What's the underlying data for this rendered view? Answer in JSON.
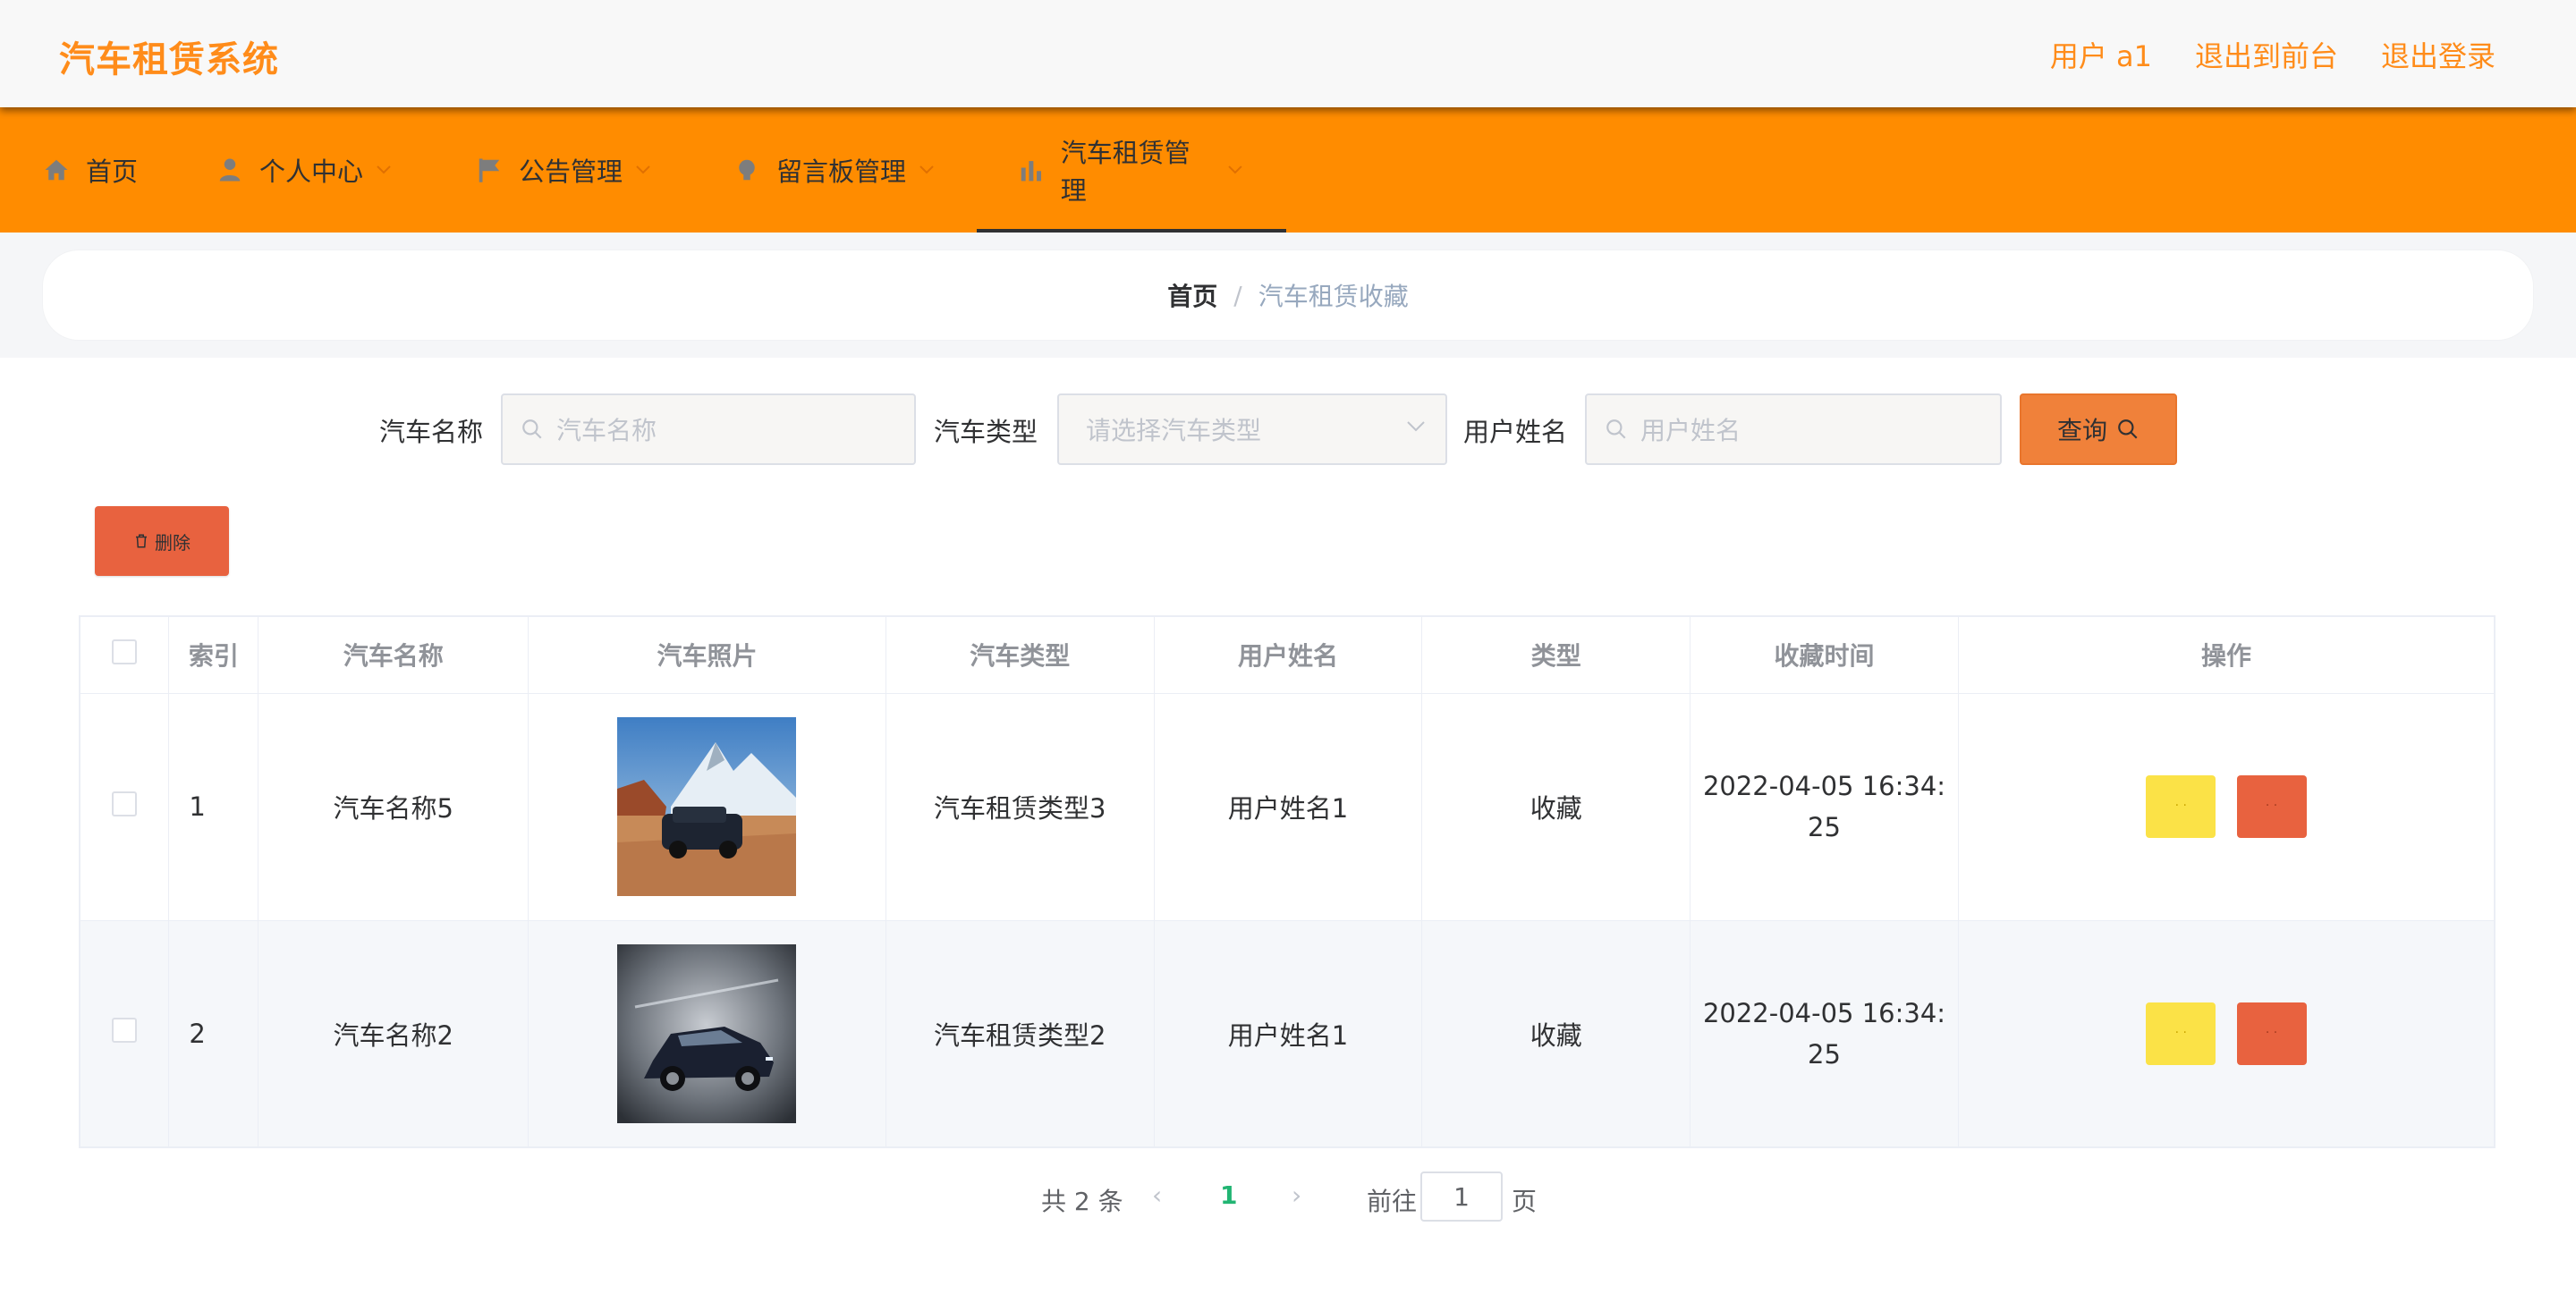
{
  "header": {
    "title": "汽车租赁系统",
    "user_label": "用户 a1",
    "to_front": "退出到前台",
    "logout": "退出登录",
    "accent_color": "#ff8c1a"
  },
  "nav": {
    "items": [
      {
        "label": "首页",
        "icon": "home-icon"
      },
      {
        "label": "个人中心",
        "icon": "user-icon"
      },
      {
        "label": "公告管理",
        "icon": "flag-icon"
      },
      {
        "label": "留言板管理",
        "icon": "bulb-icon"
      },
      {
        "label": "汽车租赁管理",
        "icon": "bar-chart-icon",
        "active": true
      }
    ],
    "bg_color": "#ff8c00"
  },
  "breadcrumb": {
    "home": "首页",
    "separator": "/",
    "current": "汽车租赁收藏"
  },
  "search": {
    "car_name_label": "汽车名称",
    "car_name_placeholder": "汽车名称",
    "car_type_label": "汽车类型",
    "car_type_placeholder": "请选择汽车类型",
    "user_name_label": "用户姓名",
    "user_name_placeholder": "用户姓名",
    "query_label": "查询"
  },
  "actions": {
    "delete_label": "删除"
  },
  "table": {
    "headers": [
      "索引",
      "汽车名称",
      "汽车照片",
      "汽车类型",
      "用户姓名",
      "类型",
      "收藏时间",
      "操作"
    ],
    "rows": [
      {
        "index": "1",
        "car_name": "汽车名称5",
        "photo": "suv-desert-photo",
        "car_type": "汽车租赁类型3",
        "user_name": "用户姓名1",
        "type": "收藏",
        "time": "2022-04-05 16:34:25",
        "time_line1": "2022-04-05 16:34:",
        "time_line2": "25"
      },
      {
        "index": "2",
        "car_name": "汽车名称2",
        "photo": "suv-studio-photo",
        "car_type": "汽车租赁类型2",
        "user_name": "用户姓名1",
        "type": "收藏",
        "time": "2022-04-05 16:34:25",
        "time_line1": "2022-04-05 16:34:",
        "time_line2": "25"
      }
    ]
  },
  "pagination": {
    "total_text": "共 2 条",
    "current_page": "1",
    "goto_label": "前往",
    "goto_value": "1",
    "page_suffix": "页"
  }
}
